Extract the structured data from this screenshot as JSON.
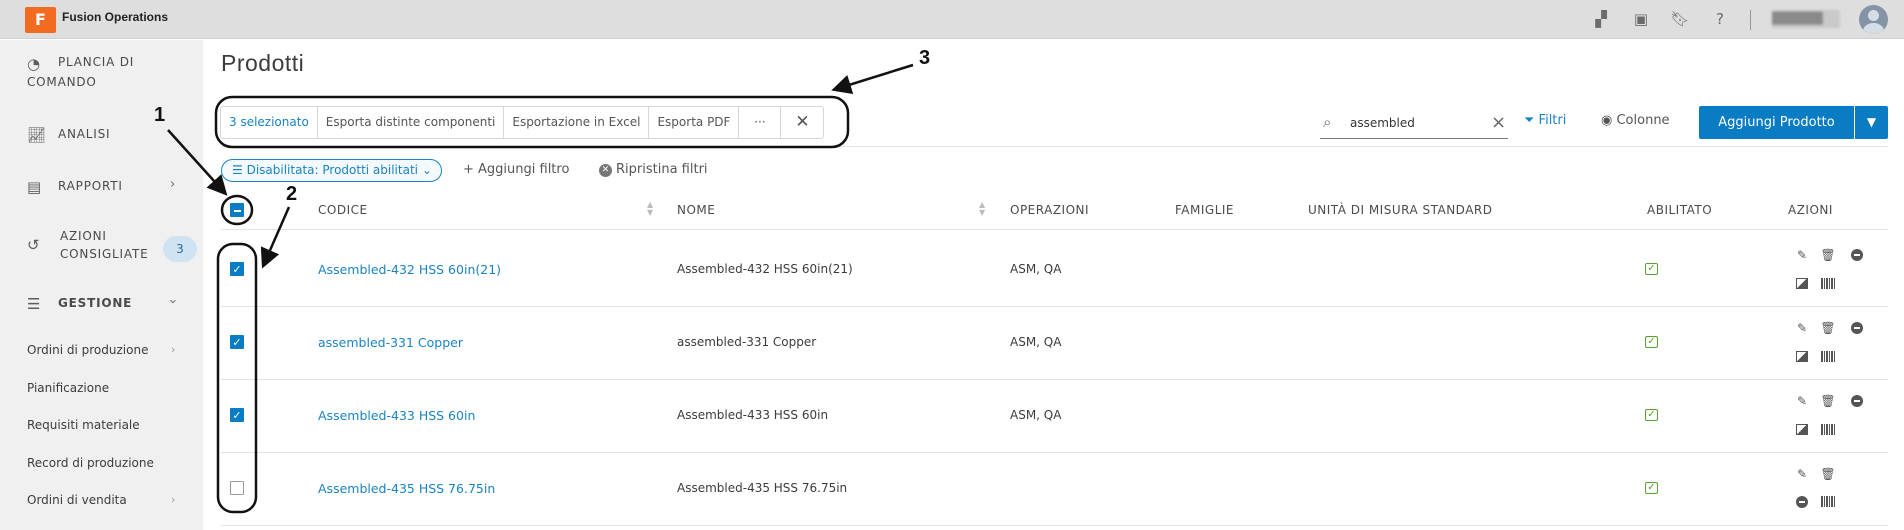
{
  "app": {
    "title": "Fusion Operations",
    "logo_letter": "F",
    "user_name": "██████"
  },
  "sidebar": {
    "items": [
      {
        "label_line1": "PLANCIA DI",
        "label_line2": "COMANDO",
        "icon": "dashboard-icon"
      },
      {
        "label": "ANALISI",
        "icon": "analytics-icon"
      },
      {
        "label": "RAPPORTI",
        "icon": "reports-icon"
      },
      {
        "label_line1": "AZIONI",
        "label_line2": "CONSIGLIATE",
        "badge": "3",
        "icon": "history-icon"
      },
      {
        "label": "GESTIONE",
        "icon": "sliders-icon"
      }
    ],
    "subitems": [
      "Ordini di produzione",
      "Pianificazione",
      "Requisiti materiale",
      "Record di produzione",
      "Ordini di vendita"
    ]
  },
  "page": {
    "title": "Prodotti"
  },
  "bulk_actions": {
    "selected": "3 selezionato",
    "export_bom": "Esporta distinte componenti",
    "export_excel": "Esportazione in Excel",
    "export_pdf": "Esporta PDF",
    "more": "···",
    "close": "✕"
  },
  "search": {
    "value": "assembled"
  },
  "toolbar": {
    "filters": "Filtri",
    "columns": "Colonne",
    "add_product": "Aggiungi Prodotto"
  },
  "filters": {
    "chip": "Disabilitata: Prodotti abilitati",
    "add": "+ Aggiungi filtro",
    "reset": "Ripristina filtri"
  },
  "table": {
    "columns": [
      "CODICE",
      "NOME",
      "OPERAZIONI",
      "FAMIGLIE",
      "UNITÀ DI MISURA STANDARD",
      "ABILITATO",
      "AZIONI"
    ],
    "rows": [
      {
        "code": "Assembled-432 HSS 60in(21)",
        "name": "Assembled-432 HSS 60in(21)",
        "operations": "ASM, QA",
        "checked": true,
        "enabled": true
      },
      {
        "code": "assembled-331 Copper",
        "name": "assembled-331 Copper",
        "operations": "ASM, QA",
        "checked": true,
        "enabled": true
      },
      {
        "code": "Assembled-433 HSS 60in",
        "name": "Assembled-433 HSS 60in",
        "operations": "ASM, QA",
        "checked": true,
        "enabled": true
      },
      {
        "code": "Assembled-435 HSS 76.75in",
        "name": "Assembled-435 HSS 76.75in",
        "operations": "",
        "checked": false,
        "enabled": true
      }
    ]
  },
  "annotations": {
    "one": "1",
    "two": "2",
    "three": "3"
  },
  "colors": {
    "accent": "#0a7cc4",
    "link": "#1a83c5",
    "logo": "#f26b21",
    "enabled": "#5aa02c"
  }
}
